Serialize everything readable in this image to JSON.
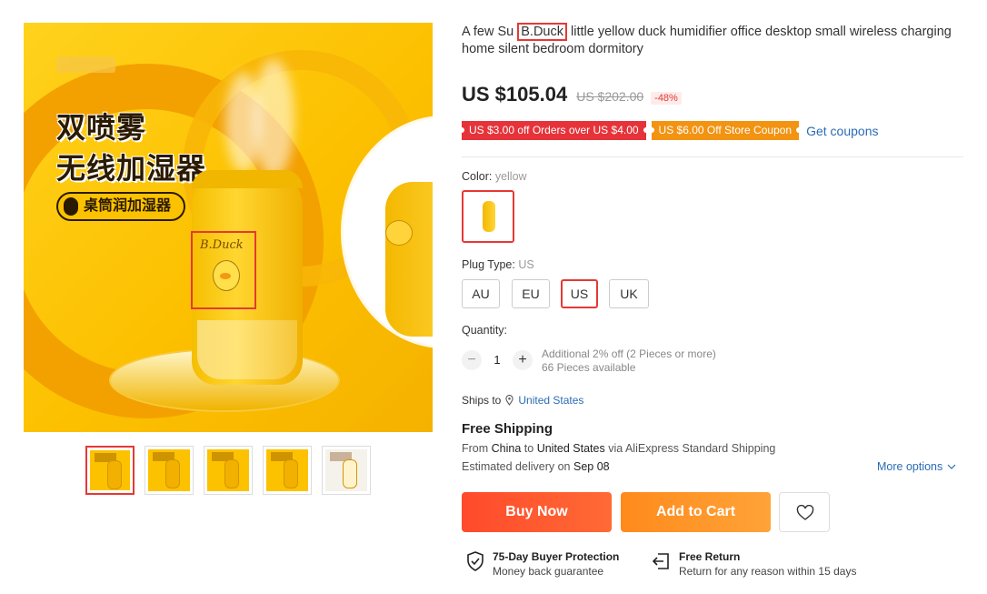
{
  "gallery": {
    "main_image": {
      "alt": "yellow duck humidifier",
      "promo_line1": "双喷雾",
      "promo_line2": "无线加湿器",
      "promo_pill": "桌筒润加湿器",
      "brand_on_device": "B.Duck"
    },
    "thumbnails": [
      "thumb-1",
      "thumb-2",
      "thumb-3",
      "thumb-4",
      "thumb-5"
    ],
    "active_thumbnail": 0
  },
  "product": {
    "title_pre": "A few Su ",
    "title_brand": "B.Duck",
    "title_post": " little yellow duck humidifier office desktop small wireless charging home silent bedroom dormitory",
    "price": "US $105.04",
    "original_price": "US $202.00",
    "discount": "-48%"
  },
  "coupons": {
    "coupon1": "US $3.00 off Orders over US $4.00",
    "coupon2": "US $6.00 Off Store Coupon",
    "get_coupons": "Get coupons"
  },
  "options": {
    "color_label": "Color:",
    "color_value": "yellow",
    "plug_label": "Plug Type:",
    "plug_value": "US",
    "plug_options": [
      "AU",
      "EU",
      "US",
      "UK"
    ],
    "plug_selected": "US"
  },
  "quantity": {
    "label": "Quantity:",
    "minus": "−",
    "value": "1",
    "plus": "+",
    "discount_note": "Additional 2% off (2 Pieces or more)",
    "available": "66 Pieces available"
  },
  "shipping": {
    "ships_to_label": "Ships to",
    "ships_to_location": "United States",
    "free_shipping": "Free Shipping",
    "from_prefix": "From ",
    "from_country": "China",
    "to_word": " to ",
    "to_country": "United States",
    "via": " via AliExpress Standard Shipping",
    "est_prefix": "Estimated delivery on ",
    "est_date": "Sep 08",
    "more_options": "More options"
  },
  "actions": {
    "buy_now": "Buy Now",
    "add_to_cart": "Add to Cart",
    "wishlist_icon": "heart-icon"
  },
  "assurances": {
    "protection_title": "75-Day Buyer Protection",
    "protection_sub": "Money back guarantee",
    "return_title": "Free Return",
    "return_sub": "Return for any reason within 15 days"
  },
  "colors": {
    "accent_red": "#e53935",
    "buy_now": "#ff4a2b",
    "add_to_cart": "#ff8a1c",
    "coupon_red": "#e6333a",
    "coupon_orange": "#f29312",
    "link_blue": "#2b6cb5"
  }
}
